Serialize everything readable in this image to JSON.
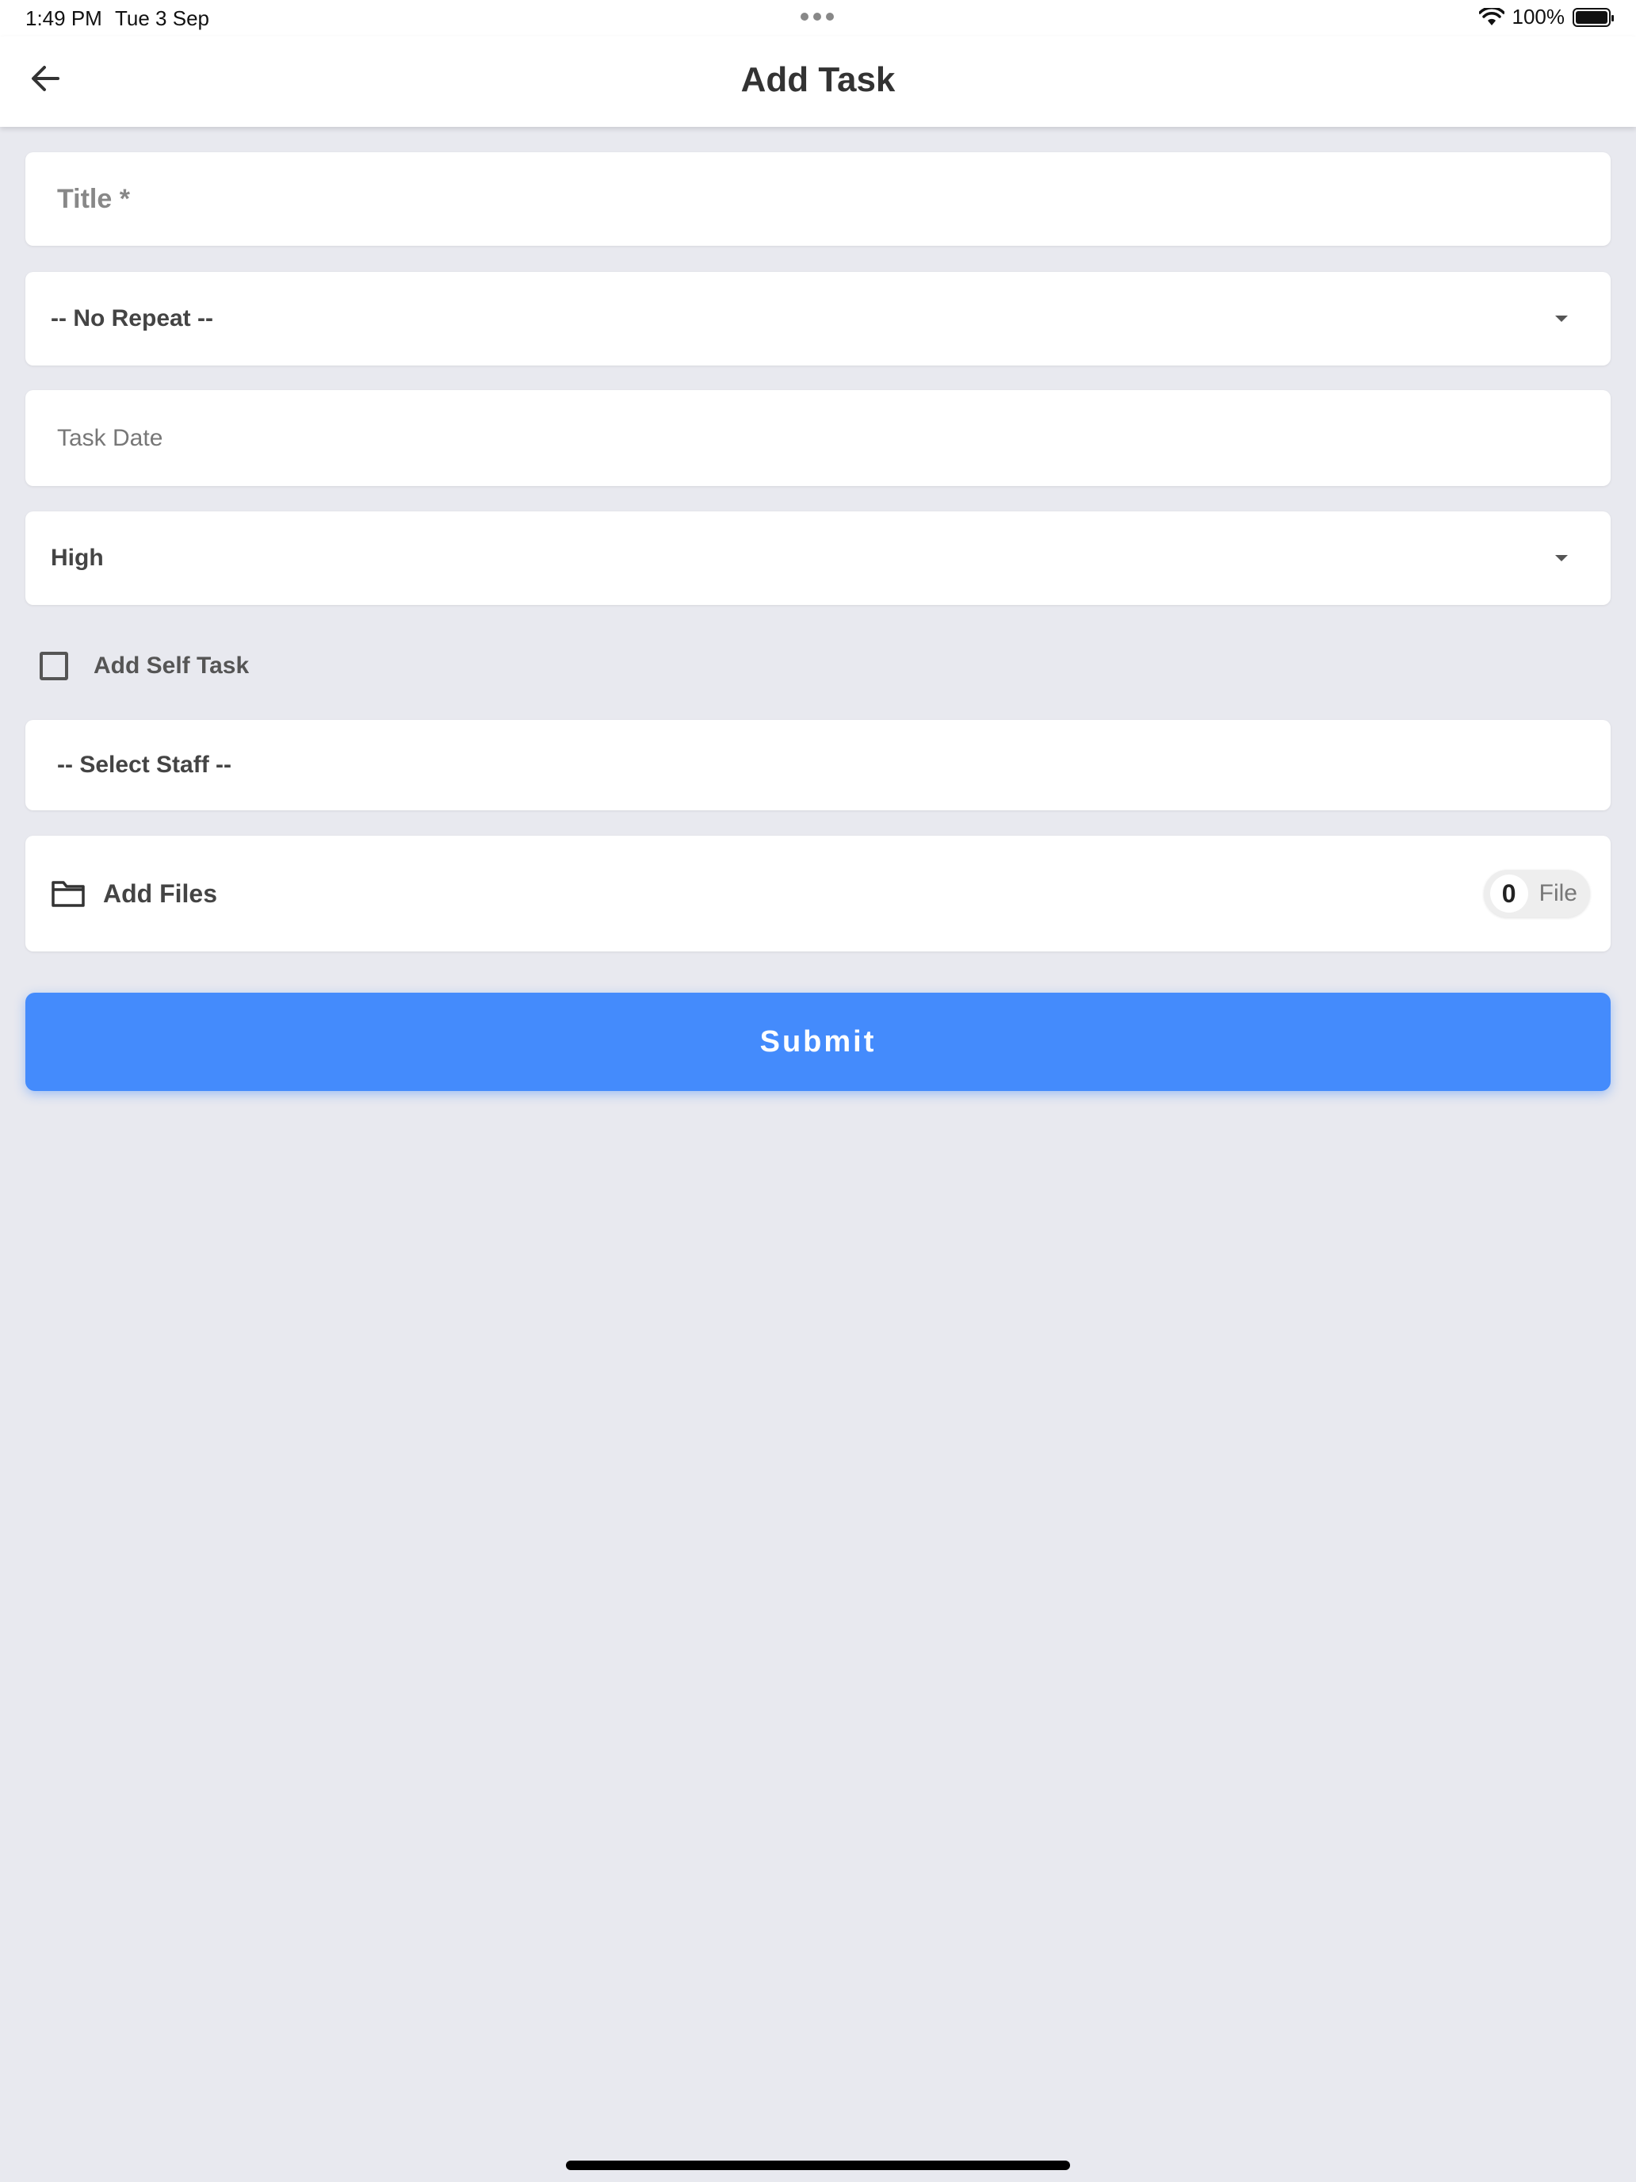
{
  "status_bar": {
    "time": "1:49 PM",
    "date": "Tue 3 Sep",
    "battery": "100%"
  },
  "header": {
    "title": "Add Task",
    "back_icon": "arrow-left-icon"
  },
  "form": {
    "title_placeholder": "Title *",
    "repeat_selected": "-- No Repeat --",
    "task_date_placeholder": "Task Date",
    "priority_selected": "High",
    "self_task_label": "Add Self Task",
    "self_task_checked": false,
    "staff_placeholder": "-- Select Staff --",
    "files_label": "Add Files",
    "file_count": "0",
    "file_count_label": "File",
    "submit_label": "Submit"
  },
  "colors": {
    "background": "#e8e9ef",
    "accent": "#448bfc",
    "card": "#ffffff"
  }
}
